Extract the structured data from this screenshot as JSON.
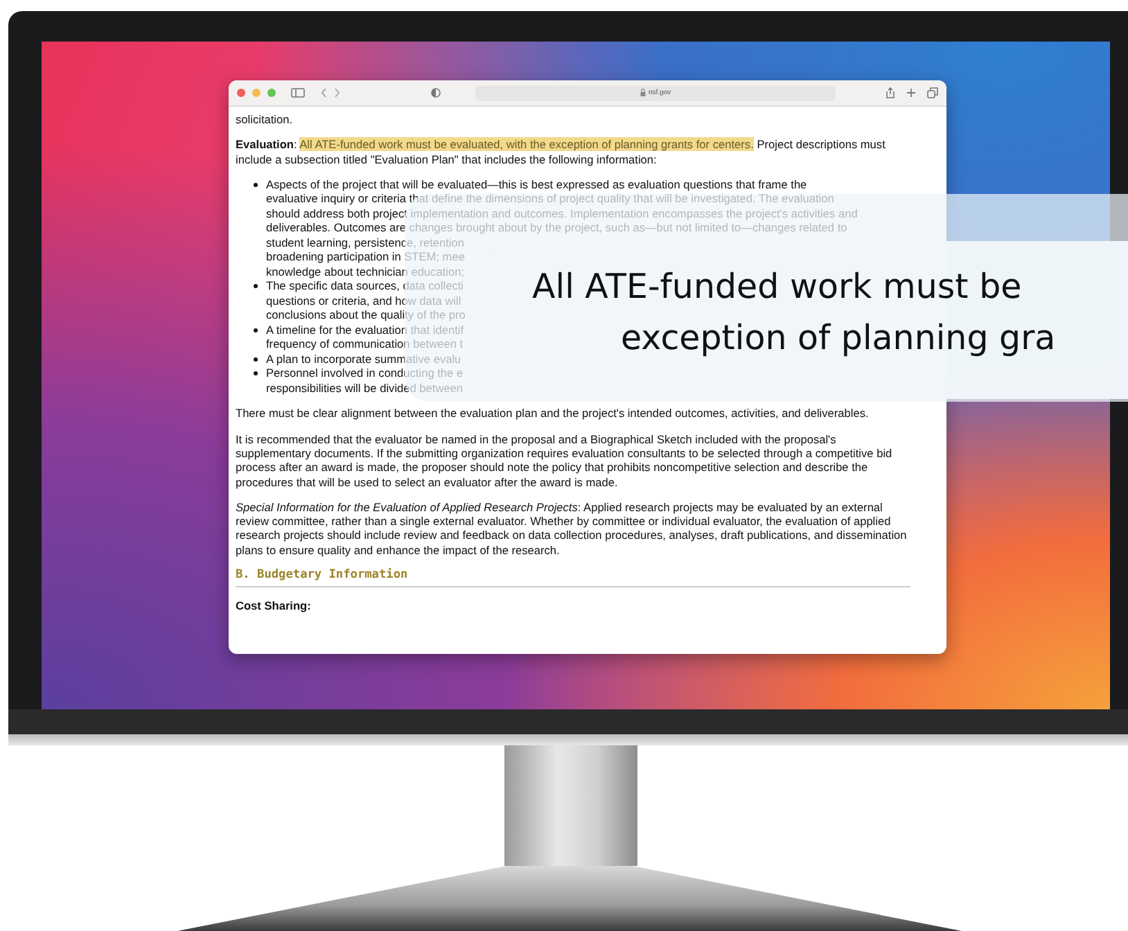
{
  "browser": {
    "url": "nsf.gov"
  },
  "document": {
    "intro": "solicitation.",
    "evaluation": {
      "lead": "**Evaluation**: ",
      "highlight": "All ATE-funded work must be evaluated, with the exception of planning grants for centers.",
      "rest": " Project descriptions must include a subsection titled \"Evaluation Plan\" that includes the following information:"
    },
    "bullets": [
      {
        "lines": [
          "Aspects of the project that will be evaluated—this is best expressed as evaluation questions that frame the",
          "evaluative inquiry or criteria that define the dimensions of project quality that will be investigated. The evaluation",
          "should address both project implementation and outcomes. Implementation encompasses the project's activities and",
          "deliverables. Outcomes are changes brought about by the project, such as—but not limited to—changes related to",
          "student learning, persistence, retention",
          "broadening participation in STEM; mee",
          "knowledge about technician education;"
        ]
      },
      {
        "lines": [
          "The specific data sources, data collecti",
          "questions or criteria, and how data will",
          "conclusions about the quality of the pro"
        ]
      },
      {
        "lines": [
          "A timeline for the evaluation that identif",
          "frequency of communication between t"
        ]
      },
      {
        "lines": [
          "A plan to incorporate summative evalu"
        ]
      },
      {
        "lines": [
          "Personnel involved in conducting the e",
          "responsibilities will be divided between"
        ]
      }
    ],
    "paragraphs": [
      "There must be clear alignment between the evaluation plan and the project's intended outcomes, activities, and deliverables.",
      "It is recommended that the evaluator be named in the proposal and a Biographical Sketch included with the proposal's supplementary documents. If the submitting organization requires evaluation consultants to be selected through a competitive bid process after an award is made, the proposer should note the policy that prohibits noncompetitive selection and describe the procedures that will be used to select an evaluator after the award is made.",
      "*Special Information for the Evaluation of Applied Research Projects*: Applied research projects may be evaluated by an external review committee, rather than a single external evaluator. Whether by committee or individual evaluator, the evaluation of applied research projects should include review and feedback on data collection procedures, analyses, draft publications, and dissemination plans to ensure quality and enhance the impact of the research."
    ],
    "section_heading": "B. Budgetary Information",
    "subheading": "Cost Sharing:"
  },
  "callout": {
    "lines": [
      "All ATE-funded work must be",
      "exception of planning gra"
    ]
  }
}
